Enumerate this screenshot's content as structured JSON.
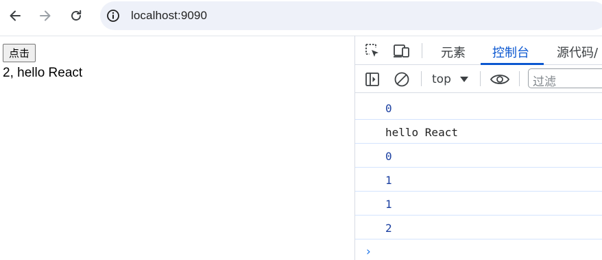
{
  "browser": {
    "url": "localhost:9090",
    "nav": {
      "back": "arrow-left-icon",
      "forward": "arrow-right-icon",
      "reload": "reload-icon"
    }
  },
  "page": {
    "button_label": "点击",
    "output_text": "2, hello React"
  },
  "devtools": {
    "tabs": [
      {
        "label": "元素",
        "active": false
      },
      {
        "label": "控制台",
        "active": true
      },
      {
        "label": "源代码/",
        "active": false
      }
    ],
    "toolbar": {
      "context": "top",
      "filter_placeholder": "过滤"
    },
    "console_logs": [
      {
        "text": "0",
        "type": "number"
      },
      {
        "text": "hello React",
        "type": "string"
      },
      {
        "text": "0",
        "type": "number"
      },
      {
        "text": "1",
        "type": "number"
      },
      {
        "text": "1",
        "type": "number"
      },
      {
        "text": "2",
        "type": "number"
      }
    ],
    "prompt": "›"
  },
  "colors": {
    "accent": "#0b57d0",
    "number": "#1a3fa0",
    "omnibox_bg": "#eef1f9",
    "row_border": "#d3e3fd"
  }
}
